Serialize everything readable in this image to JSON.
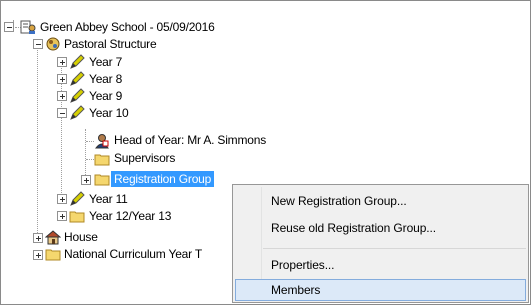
{
  "tree": {
    "root": {
      "label": "Green Abbey School - 05/09/2016",
      "icon": "school-icon"
    },
    "pastoral": {
      "label": "Pastoral Structure",
      "icon": "pastoral-icon"
    },
    "years": [
      {
        "label": "Year  7",
        "icon": "year-pencil-icon"
      },
      {
        "label": "Year  8",
        "icon": "year-pencil-icon"
      },
      {
        "label": "Year  9",
        "icon": "year-pencil-icon"
      },
      {
        "label": "Year 10",
        "icon": "year-pencil-icon"
      }
    ],
    "year10_children": {
      "head": {
        "label": "Head of Year: Mr A. Simmons",
        "icon": "person-icon"
      },
      "supervisors": {
        "label": "Supervisors",
        "icon": "folder-icon"
      },
      "registration": {
        "label": "Registration Group",
        "icon": "folder-icon"
      }
    },
    "year11": {
      "label": "Year 11",
      "icon": "year-pencil-icon"
    },
    "year1213": {
      "label": "Year 12/Year 13",
      "icon": "folder-icon"
    },
    "house": {
      "label": "House",
      "icon": "house-icon"
    },
    "ncy": {
      "label": "National Curriculum Year T",
      "icon": "folder-icon"
    }
  },
  "context_menu": {
    "items": [
      {
        "label": "New Registration Group..."
      },
      {
        "label": "Reuse old Registration Group..."
      },
      {
        "label": "Properties..."
      },
      {
        "label": "Members"
      }
    ],
    "highlighted": "Members"
  },
  "colors": {
    "selection": "#3399ff",
    "menu_bg": "#f0f0f0",
    "menu_hilite": "#dce9f8",
    "folder": "#f5d76e",
    "pencil": "#c8c800"
  }
}
